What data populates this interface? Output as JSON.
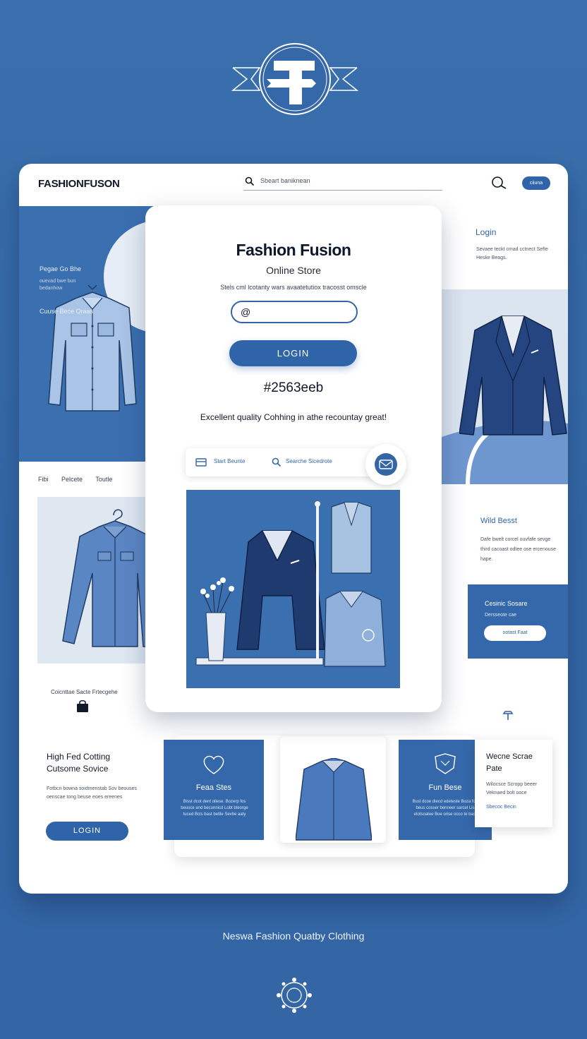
{
  "header": {
    "brand": "FASHIONFUSON",
    "search_placeholder": "Sbeart baniknean",
    "pill_label": "ciiuna"
  },
  "left_panel": {
    "heading": "Pegae Go Bhe",
    "desc": "ouevad bwe bun bedanhow",
    "subheading": "Cuuse Bece Oraas",
    "nav": [
      "Fibi",
      "Pelcete",
      "Toutle"
    ],
    "caption": "Coicnttae Sacte Frtecgehe",
    "feature_title": "High Fed Cotting Cutsome Sovice",
    "feature_desc": "Fotbcn bowna soidmenstab Sov beouses oenscae tong beuse eoes ereenes",
    "feature_button": "LOGIN"
  },
  "center_panel": {
    "title": "Fashion Fusion",
    "subtitle": "Online Store",
    "description": "Stels cml lcotanty wars avaatetutiox tracosst omscle",
    "input_value": "@",
    "login_button": "LOGIN",
    "color_code": "#2563eeb",
    "tagline": "Excellent quality Cohhing in athe recountay great!",
    "search_item_1": "Start Beunte",
    "search_item_2": "Searche Sicedrote"
  },
  "right_panel": {
    "login_link": "Login",
    "desc": "Sevaee teckt cmad cctnect Sefte Heske Beags.",
    "wild_title": "Wild Besst",
    "wild_desc": "Dafe bwelt corcel ouvfafe sevge third cacoast odtee ose ercenouse hape.",
    "cs_title": "Cesinic Sosare",
    "cs_sub": "Dersseote cae",
    "cs_button": "ootast Faat",
    "side_title": "Wecne Scrae Pate",
    "side_desc": "Wilocsce Scropp beeer Veknaed bolt ooce",
    "side_link": "Sbecoc Becin"
  },
  "tiles": [
    {
      "title": "Feaa Stes",
      "desc": "Bisst dcot dent ollese. Bozerp fos beusce and becunnicd Lobt bteorge tuced Bcts bast betlle Sevbe aaty"
    },
    {
      "title": "Fun Bese",
      "desc": "Bsst dcoe diecd edeteste Boza foe beus cosser benneer sarcel Lis etotsoatee Boe orise occo te bast"
    }
  ],
  "footer": {
    "text": "Neswa Fashion Quatby Clothing"
  },
  "colors": {
    "background": "#3568a8",
    "accent": "#2f64a8",
    "light_panel": "#dfe7f1"
  }
}
